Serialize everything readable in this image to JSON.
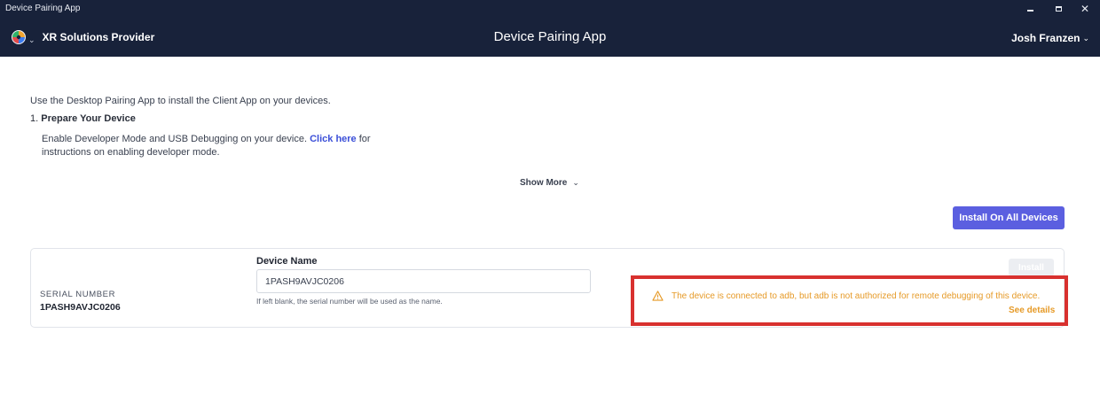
{
  "window": {
    "title": "Device Pairing App"
  },
  "header": {
    "org_name": "XR Solutions Provider",
    "app_title": "Device Pairing App",
    "user_name": "Josh Franzen"
  },
  "intro": {
    "text": "Use the Desktop Pairing App to install the Client App on your devices."
  },
  "step1": {
    "number": "1.",
    "title": "Prepare Your Device",
    "desc_before": "Enable Developer Mode and USB Debugging on your device.",
    "link_text": "Click here",
    "desc_after": "for instructions on enabling developer mode."
  },
  "show_more": {
    "label": "Show More"
  },
  "actions": {
    "install_all_label": "Install On All Devices"
  },
  "device": {
    "serial_label": "SERIAL NUMBER",
    "serial_value": "1PASH9AVJC0206",
    "name_label": "Device Name",
    "name_value": "1PASH9AVJC0206",
    "name_help": "If left blank, the serial number will be used as the name.",
    "install_label": "Install",
    "warning_text": "The device is connected to adb, but adb is not authorized for remote debugging of this device.",
    "see_details_label": "See details"
  },
  "colors": {
    "header_bg": "#18223a",
    "accent": "#5b5fe0",
    "link": "#3b4fd8",
    "warning": "#e69a27",
    "highlight_border": "#d8312f"
  },
  "icons": {
    "org_logo": "org-logo-icon",
    "warning": "warning-triangle-icon"
  }
}
